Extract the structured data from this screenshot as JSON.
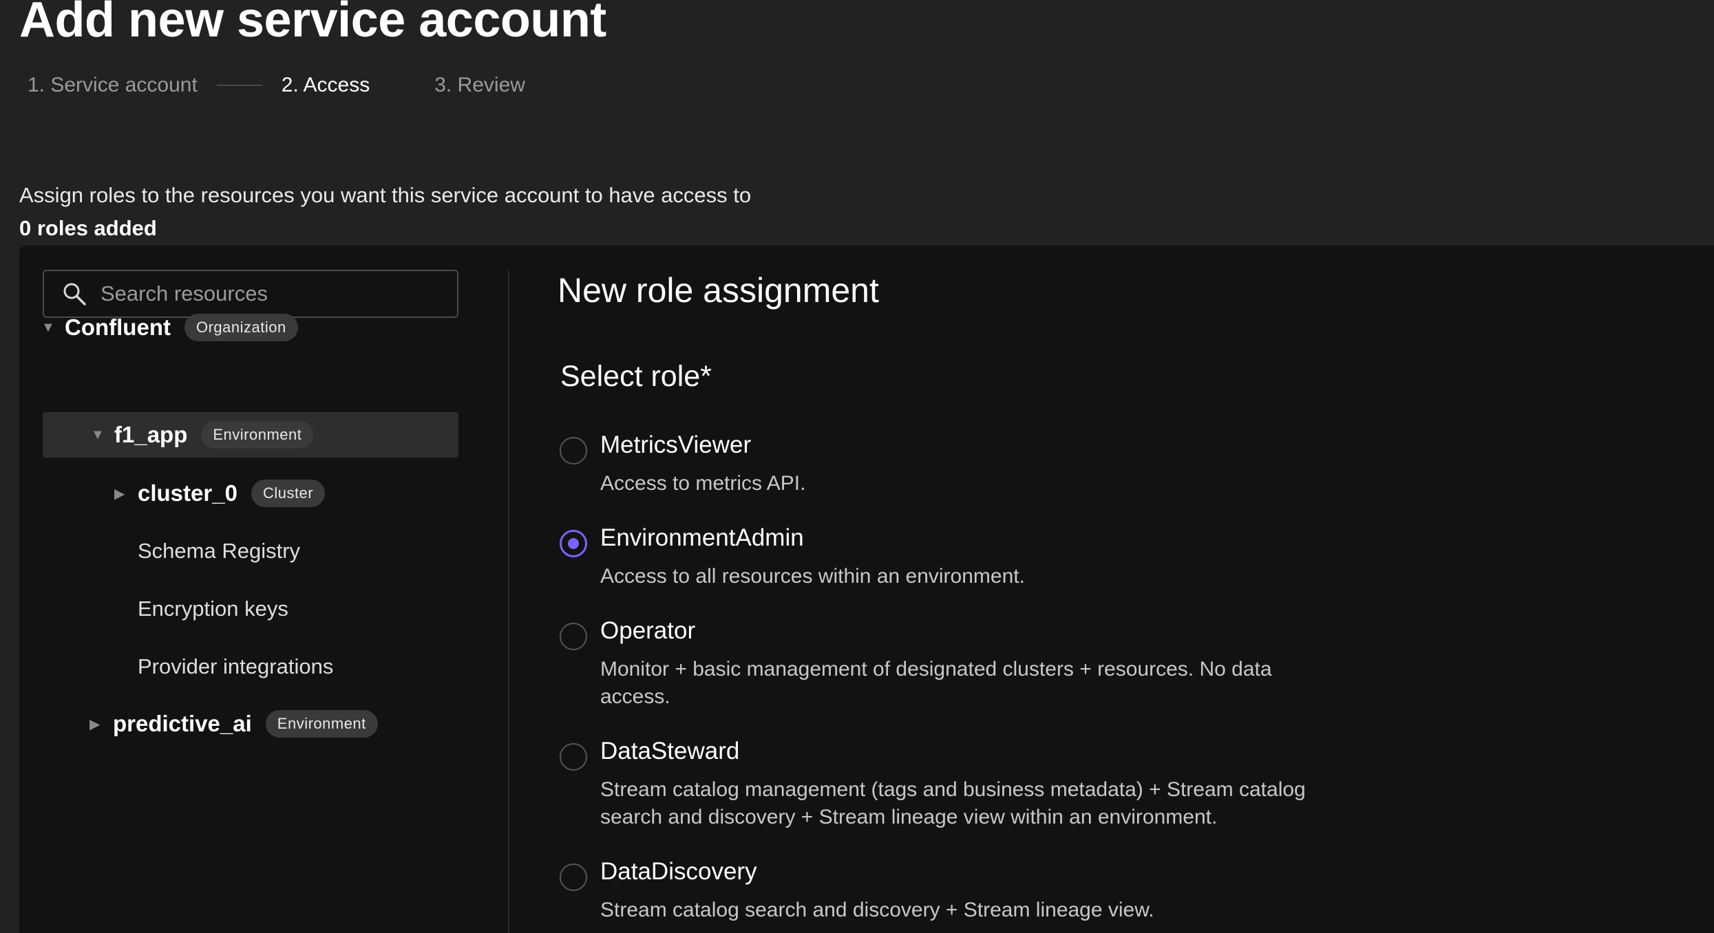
{
  "page": {
    "title": "Add new service account",
    "steps": [
      "1. Service account",
      "2. Access",
      "3. Review"
    ],
    "active_step": 1,
    "intro": "Assign roles to the resources you want this service account to have access to",
    "roles_added": "0 roles added"
  },
  "search": {
    "placeholder": "Search resources"
  },
  "tree": [
    {
      "name": "Confluent",
      "badge": "Organization",
      "caret": "▼"
    },
    {
      "name": "f1_app",
      "badge": "Environment",
      "caret": "▼",
      "selected": true
    },
    {
      "name": "cluster_0",
      "badge": "Cluster",
      "caret": "▶"
    },
    {
      "name": "Schema Registry"
    },
    {
      "name": "Encryption keys"
    },
    {
      "name": "Provider integrations"
    },
    {
      "name": "predictive_ai",
      "badge": "Environment",
      "caret": "▶"
    }
  ],
  "assignment": {
    "heading": "New role assignment",
    "select_label": "Select role*",
    "roles": [
      {
        "name": "MetricsViewer",
        "desc": "Access to metrics API.",
        "checked": false
      },
      {
        "name": "EnvironmentAdmin",
        "desc": "Access to all resources within an environment.",
        "checked": true
      },
      {
        "name": "Operator",
        "desc": "Monitor + basic management of designated clusters + resources. No data access.",
        "checked": false
      },
      {
        "name": "DataSteward",
        "desc": "Stream catalog management (tags and business metadata) + Stream catalog search and discovery + Stream lineage view within an environment.",
        "checked": false
      },
      {
        "name": "DataDiscovery",
        "desc": "Stream catalog search and discovery + Stream lineage view.",
        "checked": false
      }
    ]
  },
  "colors": {
    "accent": "#7b62ff",
    "background": "#222222",
    "panel": "#121212"
  }
}
